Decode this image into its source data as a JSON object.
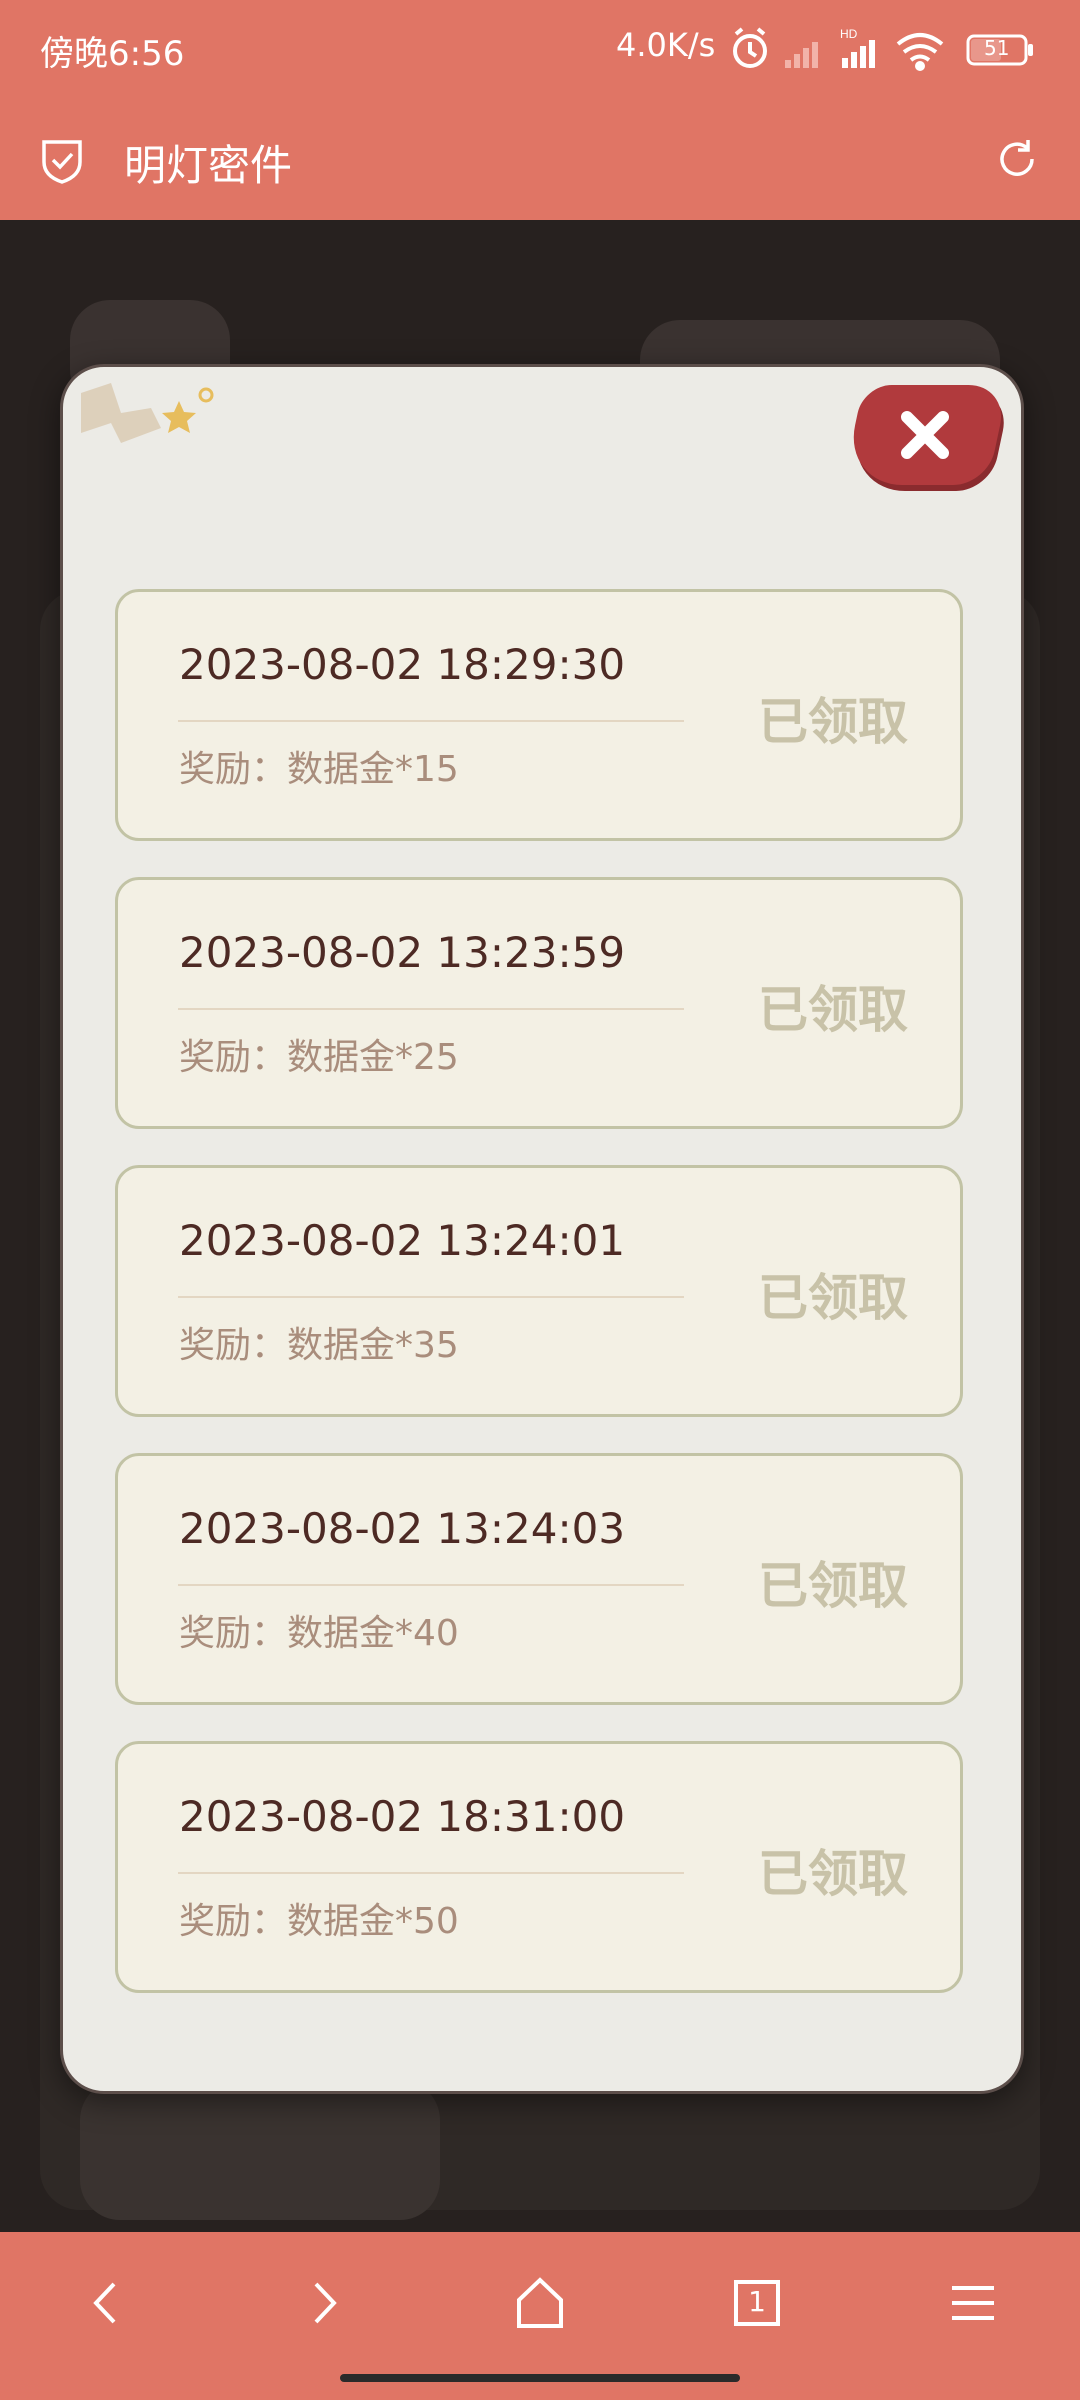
{
  "status_bar": {
    "time": "傍晚6:56",
    "network_speed": "4.0K/s",
    "battery": "51",
    "icons": [
      "alarm-icon",
      "signal-icon",
      "hd-signal-icon",
      "wifi-icon",
      "battery-icon"
    ]
  },
  "header": {
    "title": "明灯密件",
    "left_icon": "shield-check-icon",
    "right_icon": "refresh-icon"
  },
  "modal": {
    "close_icon": "close-icon",
    "records": [
      {
        "timestamp": "2023-08-02  18:29:30",
        "reward": "奖励：数据金*15",
        "status": "已领取"
      },
      {
        "timestamp": "2023-08-02  13:23:59",
        "reward": "奖励：数据金*25",
        "status": "已领取"
      },
      {
        "timestamp": "2023-08-02  13:24:01",
        "reward": "奖励：数据金*35",
        "status": "已领取"
      },
      {
        "timestamp": "2023-08-02  13:24:03",
        "reward": "奖励：数据金*40",
        "status": "已领取"
      },
      {
        "timestamp": "2023-08-02  18:31:00",
        "reward": "奖励：数据金*50",
        "status": "已领取"
      }
    ]
  },
  "bottom_nav": {
    "items": [
      "back-icon",
      "forward-icon",
      "home-icon",
      "tabs-icon",
      "menu-icon"
    ],
    "tab_count": "1"
  },
  "colors": {
    "accent": "#e07565",
    "modal_bg": "#ecebe6",
    "card_bg": "#f3f0e4",
    "card_border": "#c2c3a5",
    "timestamp_text": "#4d2a24",
    "reward_text": "#a98d7c",
    "claimed_text": "#c8c2a8",
    "close_button": "#b13a3d"
  }
}
